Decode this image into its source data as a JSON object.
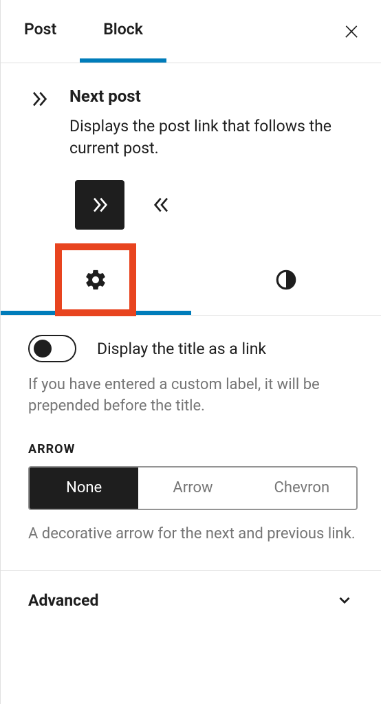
{
  "tabs": {
    "post": "Post",
    "block": "Block",
    "active": "block"
  },
  "block": {
    "title": "Next post",
    "description": "Displays the post link that follows the current post."
  },
  "variants": {
    "next_active": true
  },
  "subtabs": {
    "active": "settings"
  },
  "settings": {
    "display_title_toggle": false,
    "display_title_label": "Display the title as a link",
    "display_title_help": "If you have entered a custom label, it will be prepended before the title.",
    "arrow": {
      "label": "Arrow",
      "options": [
        "None",
        "Arrow",
        "Chevron"
      ],
      "selected": "None",
      "help": "A decorative arrow for the next and previous link."
    }
  },
  "advanced": {
    "label": "Advanced"
  }
}
